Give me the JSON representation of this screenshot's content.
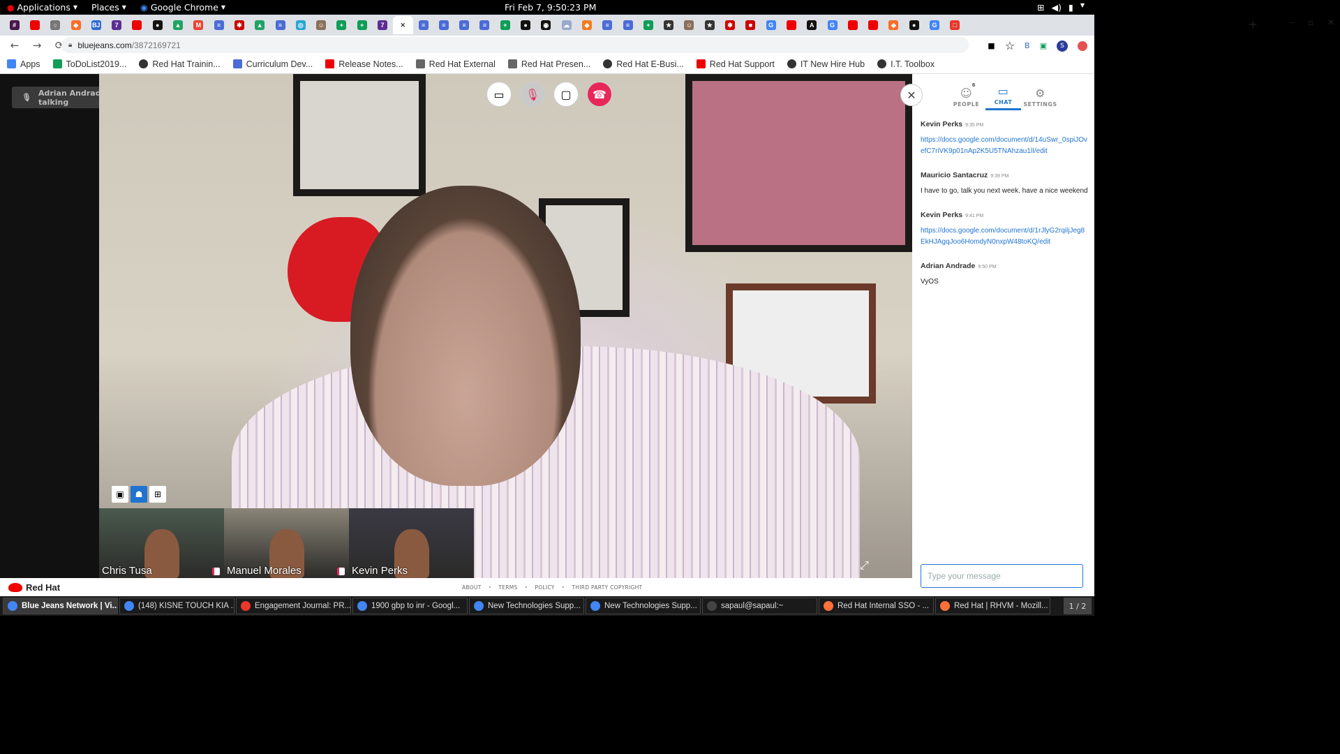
{
  "topbar": {
    "applications": "Applications",
    "places": "Places",
    "browser": "Google Chrome",
    "clock": "Fri Feb  7,  9:50:23 PM"
  },
  "tabs": [
    {
      "color": "#4a154b",
      "glyph": "#"
    },
    {
      "color": "#e00",
      "glyph": ""
    },
    {
      "color": "#777",
      "glyph": "○"
    },
    {
      "color": "#fc6d26",
      "glyph": "◆"
    },
    {
      "color": "#2f6bd1",
      "glyph": "BJ"
    },
    {
      "color": "#5c2d91",
      "glyph": "7"
    },
    {
      "color": "#e00",
      "glyph": ""
    },
    {
      "color": "#111",
      "glyph": "●"
    },
    {
      "color": "#1fa463",
      "glyph": "▲"
    },
    {
      "color": "#ea4335",
      "glyph": "M"
    },
    {
      "color": "#4b6bd6",
      "glyph": "≡"
    },
    {
      "color": "#c00",
      "glyph": "✱"
    },
    {
      "color": "#1fa463",
      "glyph": "▲"
    },
    {
      "color": "#4b6bd6",
      "glyph": "≡"
    },
    {
      "color": "#2aa5d6",
      "glyph": "◎"
    },
    {
      "color": "#8a6f5a",
      "glyph": "☺"
    },
    {
      "color": "#0f9d58",
      "glyph": "+"
    },
    {
      "color": "#0f9d58",
      "glyph": "+"
    },
    {
      "color": "#5c2d91",
      "glyph": "7"
    },
    {
      "color": "#fff",
      "glyph": "✕",
      "active": true
    },
    {
      "color": "#4b6bd6",
      "glyph": "≡"
    },
    {
      "color": "#4b6bd6",
      "glyph": "≡"
    },
    {
      "color": "#4b6bd6",
      "glyph": "≡"
    },
    {
      "color": "#4b6bd6",
      "glyph": "≡"
    },
    {
      "color": "#0f9d58",
      "glyph": "+"
    },
    {
      "color": "#111",
      "glyph": "●"
    },
    {
      "color": "#111",
      "glyph": "◉"
    },
    {
      "color": "#9ac",
      "glyph": "☁"
    },
    {
      "color": "#f47c20",
      "glyph": "◆"
    },
    {
      "color": "#4b6bd6",
      "glyph": "≡"
    },
    {
      "color": "#4b6bd6",
      "glyph": "≡"
    },
    {
      "color": "#0f9d58",
      "glyph": "+"
    },
    {
      "color": "#333",
      "glyph": "★"
    },
    {
      "color": "#8a6f5a",
      "glyph": "☺"
    },
    {
      "color": "#333",
      "glyph": "★"
    },
    {
      "color": "#c00",
      "glyph": "✱"
    },
    {
      "color": "#c00",
      "glyph": "■"
    },
    {
      "color": "#4285f4",
      "glyph": "G"
    },
    {
      "color": "#e00",
      "glyph": ""
    },
    {
      "color": "#111",
      "glyph": "A"
    },
    {
      "color": "#4285f4",
      "glyph": "G"
    },
    {
      "color": "#e00",
      "glyph": ""
    },
    {
      "color": "#e00",
      "glyph": ""
    },
    {
      "color": "#fc6d26",
      "glyph": "◆"
    },
    {
      "color": "#111",
      "glyph": "●"
    },
    {
      "color": "#4285f4",
      "glyph": "G"
    },
    {
      "color": "#e8382b",
      "glyph": "□"
    }
  ],
  "address": {
    "host": "bluejeans.com",
    "path": "/3872169721"
  },
  "bookmarks": [
    {
      "label": "Apps",
      "color": "#4285f4",
      "icon": "apps-grid-icon"
    },
    {
      "label": "ToDoList2019...",
      "color": "#0f9d58",
      "icon": "sheets-icon"
    },
    {
      "label": "Red Hat Trainin...",
      "color": "#333",
      "icon": "globe-icon"
    },
    {
      "label": "Curriculum Dev...",
      "color": "#4b6bd6",
      "icon": "docs-icon"
    },
    {
      "label": "Release Notes...",
      "color": "#e00",
      "icon": "redhat-icon"
    },
    {
      "label": "Red Hat External",
      "color": "#666",
      "icon": "folder-icon"
    },
    {
      "label": "Red Hat Presen...",
      "color": "#666",
      "icon": "folder-icon"
    },
    {
      "label": "Red Hat E-Busi...",
      "color": "#333",
      "icon": "globe-icon"
    },
    {
      "label": "Red Hat Support",
      "color": "#e00",
      "icon": "servicenow-icon"
    },
    {
      "label": "IT New Hire Hub",
      "color": "#333",
      "icon": "globe-icon"
    },
    {
      "label": "I.T. Toolbox",
      "color": "#333",
      "icon": "globe-icon"
    }
  ],
  "meeting": {
    "talking_banner": "Adrian Andrade is talking",
    "participants": [
      {
        "name": "Chris Tusa",
        "bg": "#4a5a4e",
        "muted": false
      },
      {
        "name": "Manuel Morales",
        "bg": "#8a8578",
        "muted": true
      },
      {
        "name": "Kevin Perks",
        "bg": "#3b3a44",
        "muted": true
      }
    ]
  },
  "panel": {
    "tabs": {
      "people": "PEOPLE",
      "people_count": "6",
      "chat": "CHAT",
      "settings": "SETTINGS"
    },
    "messages": [
      {
        "author": "Kevin Perks",
        "time": "9:35 PM",
        "text": "https://docs.google.com/document/d/14uSwr_0spiJOvefC7riVK9p01nAp2K5U5TNAhzau1lI/edit",
        "link": true
      },
      {
        "author": "Mauricio Santacruz",
        "time": "9:39 PM",
        "text": "I have to go, talk you next week. have a nice weekend",
        "link": false
      },
      {
        "author": "Kevin Perks",
        "time": "9:41 PM",
        "text": "https://docs.google.com/document/d/1rJlyG2rqiljJeg8EkHJAgqJoo6HomdyN0nxpW48toKQ/edit",
        "link": true
      },
      {
        "author": "Adrian Andrade",
        "time": "9:50 PM",
        "text": "VyOS",
        "link": false
      }
    ],
    "input_placeholder": "Type your message"
  },
  "footer": {
    "brand": "Red Hat",
    "links": [
      "ABOUT",
      "TERMS",
      "POLICY",
      "THIRD PARTY COPYRIGHT"
    ]
  },
  "taskbar": {
    "windows": [
      {
        "label": "Blue Jeans Network | Vi...",
        "color": "#4285f4",
        "active": true
      },
      {
        "label": "(148) KISNE TOUCH KIA ...",
        "color": "#4285f4",
        "active": false
      },
      {
        "label": "Engagement Journal: PR...",
        "color": "#e8382b",
        "active": false
      },
      {
        "label": "1900 gbp to inr - Googl...",
        "color": "#4285f4",
        "active": false
      },
      {
        "label": "New Technologies Supp...",
        "color": "#4285f4",
        "active": false
      },
      {
        "label": "New Technologies Supp...",
        "color": "#4285f4",
        "active": false
      },
      {
        "label": "sapaul@sapaul:~",
        "color": "#444",
        "active": false
      },
      {
        "label": "Red Hat Internal SSO - ...",
        "color": "#ff7139",
        "active": false
      },
      {
        "label": "Red Hat | RHVM - Mozill...",
        "color": "#ff7139",
        "active": false
      }
    ],
    "pager": "1 / 2"
  }
}
